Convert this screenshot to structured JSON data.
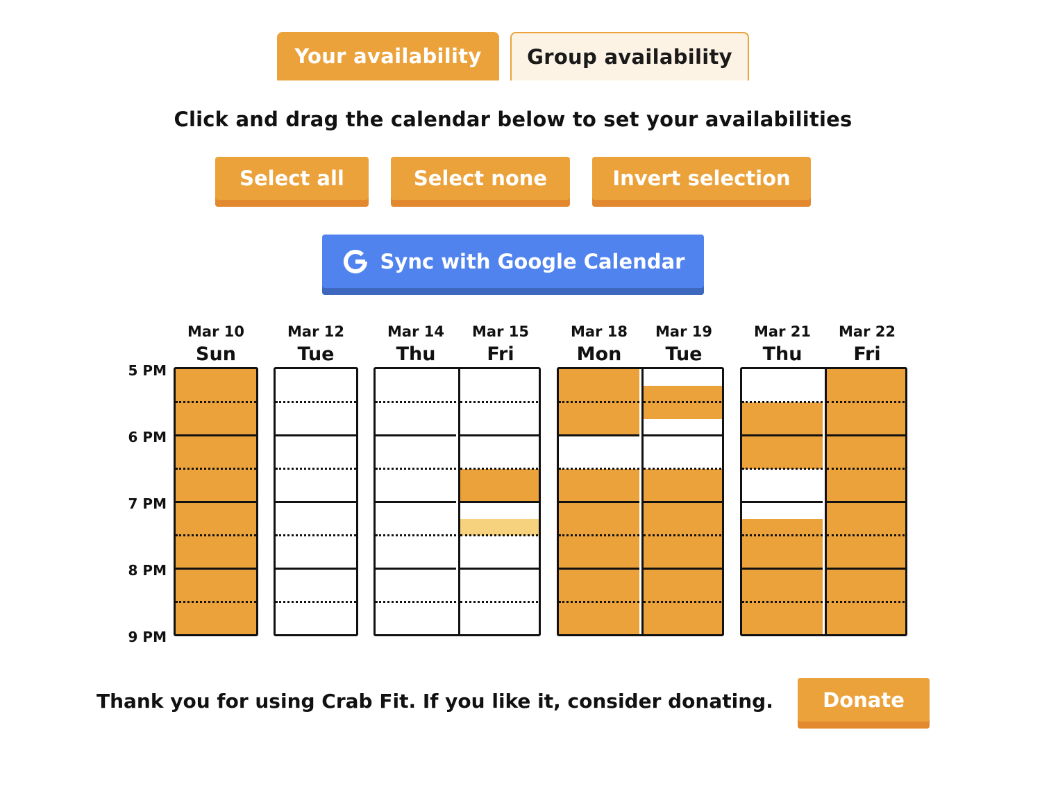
{
  "tabs": {
    "your_availability": "Your availability",
    "group_availability": "Group availability"
  },
  "instruction": "Click and drag the calendar below to set your availabilities",
  "buttons": {
    "select_all": "Select all",
    "select_none": "Select none",
    "invert_selection": "Invert selection",
    "google_sync": "Sync with Google Calendar"
  },
  "time_labels": [
    "5 PM",
    "6 PM",
    "7 PM",
    "8 PM",
    "9 PM"
  ],
  "calendar": {
    "groups": [
      {
        "days": [
          {
            "date": "Mar 10",
            "day": "Sun",
            "slots": [
              1,
              1,
              1,
              1,
              1,
              1,
              1,
              1,
              1,
              1,
              1,
              1,
              1,
              1,
              1,
              1
            ]
          }
        ]
      },
      {
        "days": [
          {
            "date": "Mar 12",
            "day": "Tue",
            "slots": [
              0,
              0,
              0,
              0,
              0,
              0,
              0,
              0,
              0,
              0,
              0,
              0,
              0,
              0,
              0,
              0
            ]
          }
        ]
      },
      {
        "days": [
          {
            "date": "Mar 14",
            "day": "Thu",
            "slots": [
              0,
              0,
              0,
              0,
              0,
              0,
              0,
              0,
              0,
              0,
              0,
              0,
              0,
              0,
              0,
              0
            ]
          },
          {
            "date": "Mar 15",
            "day": "Fri",
            "slots": [
              0,
              0,
              0,
              0,
              0,
              0,
              1,
              1,
              0,
              2,
              0,
              0,
              0,
              0,
              0,
              0
            ]
          }
        ]
      },
      {
        "days": [
          {
            "date": "Mar 18",
            "day": "Mon",
            "slots": [
              1,
              1,
              1,
              1,
              0,
              0,
              1,
              1,
              1,
              1,
              1,
              1,
              1,
              1,
              1,
              1
            ]
          },
          {
            "date": "Mar 19",
            "day": "Tue",
            "slots": [
              0,
              1,
              1,
              0,
              0,
              0,
              1,
              1,
              1,
              1,
              1,
              1,
              1,
              1,
              1,
              1
            ]
          }
        ]
      },
      {
        "days": [
          {
            "date": "Mar 21",
            "day": "Thu",
            "slots": [
              0,
              0,
              1,
              1,
              1,
              1,
              0,
              0,
              0,
              1,
              1,
              1,
              1,
              1,
              1,
              1
            ]
          },
          {
            "date": "Mar 22",
            "day": "Fri",
            "slots": [
              1,
              1,
              1,
              1,
              1,
              1,
              1,
              1,
              1,
              1,
              1,
              1,
              1,
              1,
              1,
              1
            ]
          }
        ]
      }
    ]
  },
  "colors": {
    "accent": "#EBA23A",
    "accent_shadow": "#E2892F",
    "tentative": "#F7D27E",
    "google_blue": "#5083EE"
  },
  "footer": {
    "text": "Thank you for using Crab Fit. If you like it, consider donating.",
    "donate_label": "Donate"
  }
}
